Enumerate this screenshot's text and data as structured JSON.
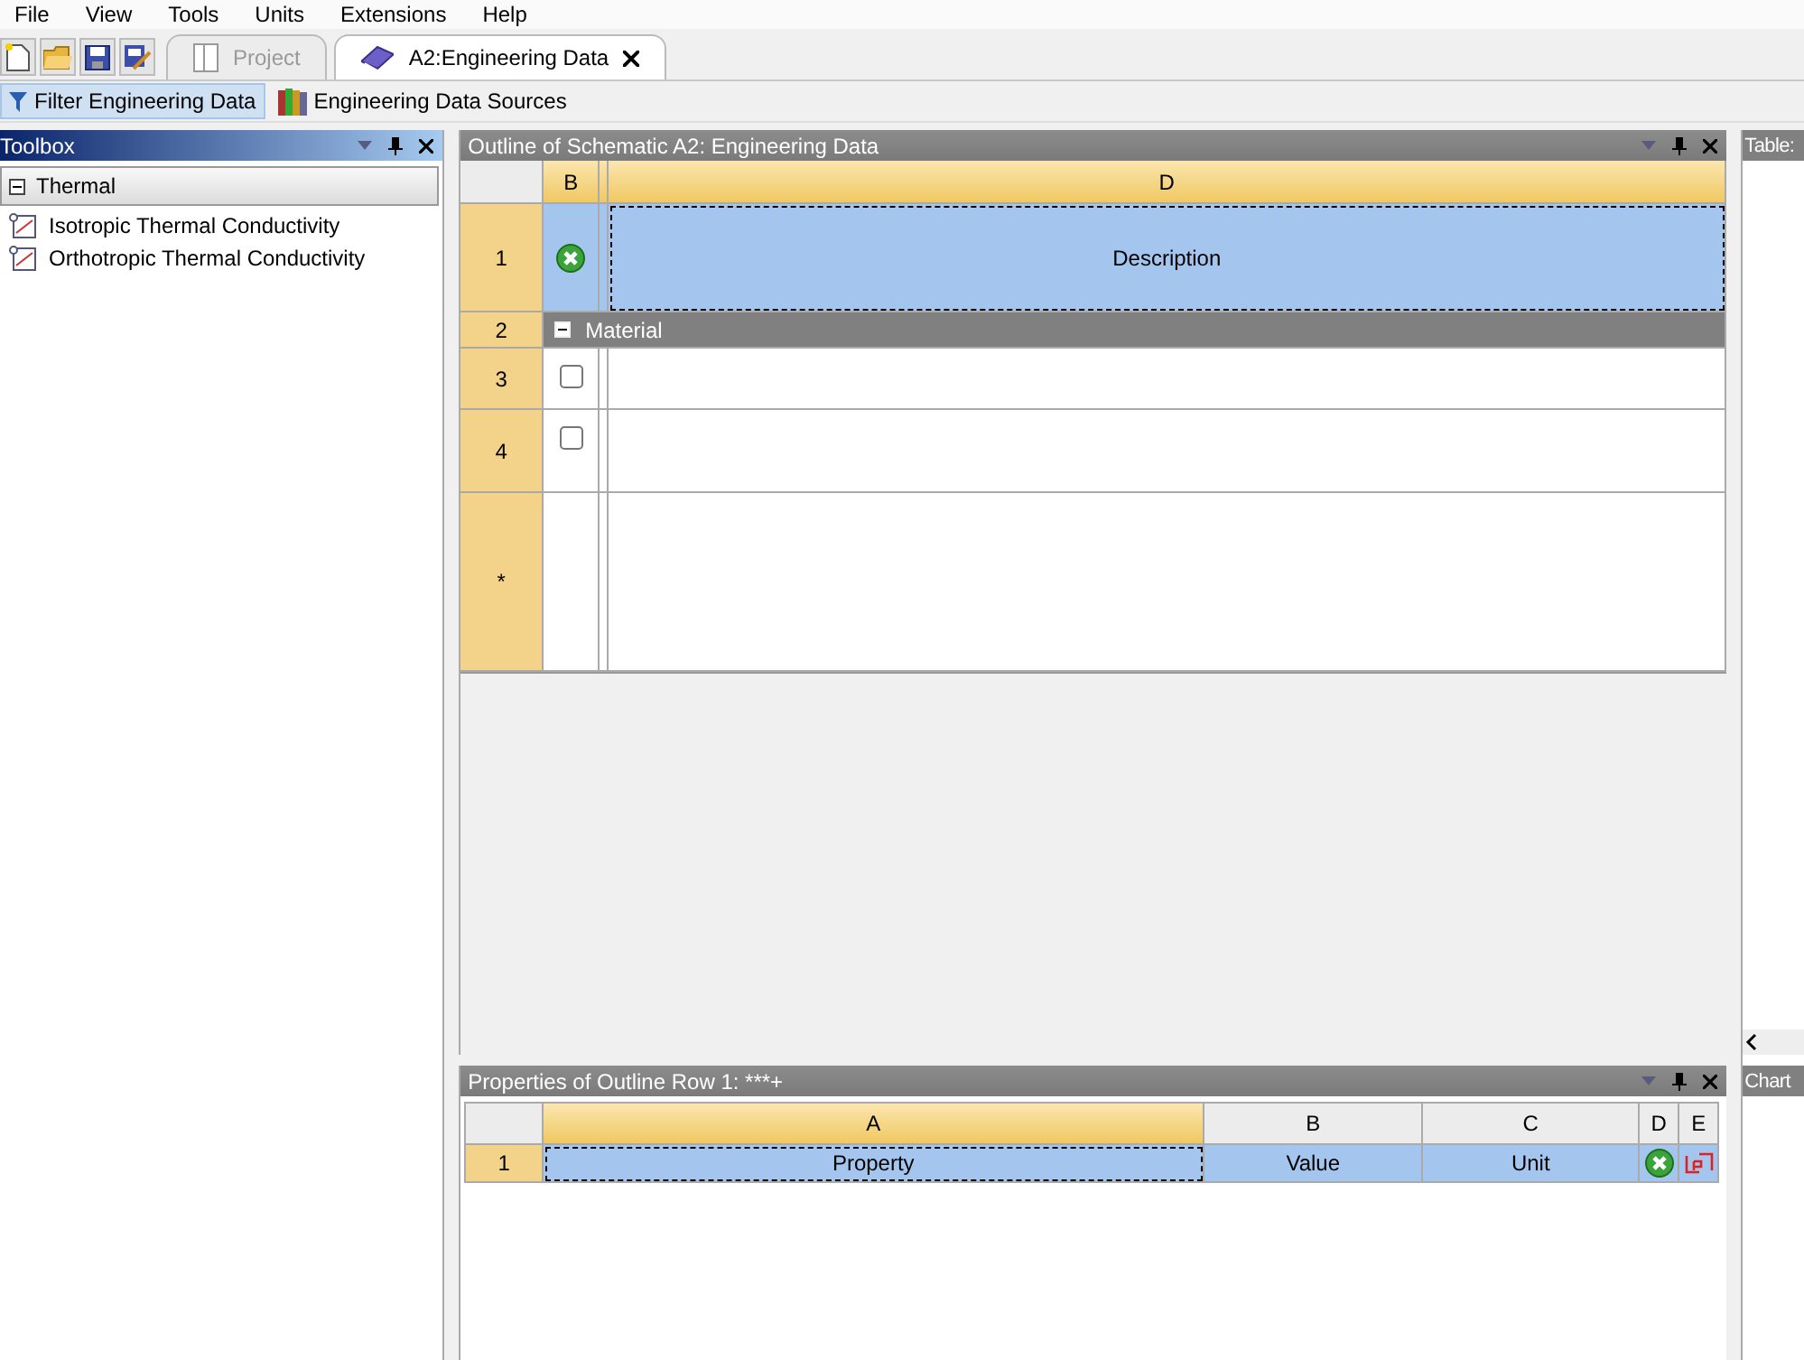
{
  "menu": [
    "File",
    "View",
    "Tools",
    "Units",
    "Extensions",
    "Help"
  ],
  "tabs": [
    {
      "label": "Project",
      "selected": false
    },
    {
      "label": "A2:Engineering Data",
      "selected": true
    }
  ],
  "subtoolbar": [
    {
      "label": "Filter Engineering Data",
      "selected": true,
      "kind": "filter"
    },
    {
      "label": "Engineering Data Sources",
      "selected": false,
      "kind": "books"
    }
  ],
  "toolbox": {
    "title": "Toolbox",
    "groups": [
      {
        "label": "Thermal",
        "expanded": true,
        "children": [
          {
            "label": "Isotropic Thermal Conductivity"
          },
          {
            "label": "Orthotropic Thermal Conductivity"
          }
        ]
      }
    ]
  },
  "outline": {
    "title": "Outline of Schematic A2: Engineering Data",
    "columns": [
      "B",
      "D"
    ],
    "rows": [
      {
        "num": "1",
        "kind": "header",
        "text": "Description",
        "selected": true
      },
      {
        "num": "2",
        "kind": "group",
        "text": "Material",
        "expanded": true
      },
      {
        "num": "3",
        "kind": "item",
        "checked": false
      },
      {
        "num": "4",
        "kind": "item",
        "checked": false
      },
      {
        "num": "*",
        "kind": "new"
      }
    ]
  },
  "properties": {
    "title": "Properties of Outline Row 1: ***+",
    "columns": [
      "A",
      "B",
      "C",
      "D",
      "E"
    ],
    "rows": [
      {
        "num": "1",
        "cells": [
          "Property",
          "Value",
          "Unit"
        ],
        "selected": true
      }
    ]
  },
  "table_panel": {
    "title": "Table:"
  },
  "chart_panel": {
    "title": "Chart"
  }
}
